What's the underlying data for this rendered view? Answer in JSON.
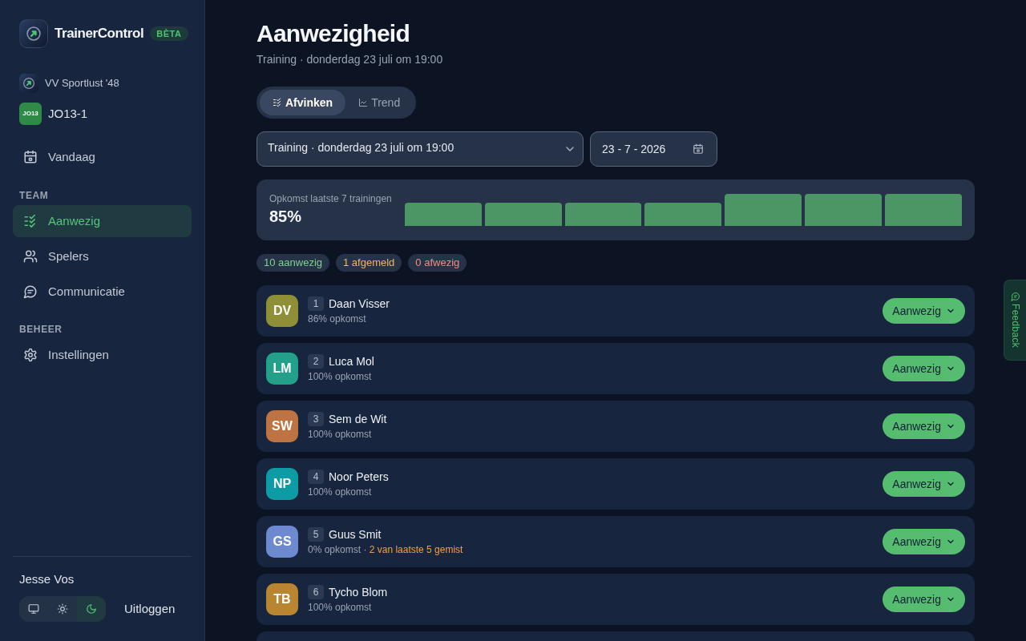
{
  "sidebar": {
    "brand": {
      "name": "TrainerControl",
      "badge": "BÈTA"
    },
    "club": {
      "name": "VV Sportlust '48"
    },
    "team": {
      "badge": "JO13",
      "name": "JO13-1"
    },
    "nav": [
      {
        "label": "Vandaag",
        "kind": "calendar",
        "selected": false
      }
    ],
    "sections": [
      {
        "title": "TEAM",
        "items": [
          {
            "label": "Aanwezig",
            "kind": "checklist",
            "selected": true
          },
          {
            "label": "Spelers",
            "kind": "users",
            "selected": false
          },
          {
            "label": "Communicatie",
            "kind": "chat",
            "selected": false
          }
        ]
      },
      {
        "title": "BEHEER",
        "items": [
          {
            "label": "Instellingen",
            "kind": "settings",
            "selected": false
          }
        ]
      }
    ],
    "user": {
      "name": "Jesse Vos"
    },
    "theme_options": [
      {
        "kind": "system",
        "selected": false
      },
      {
        "kind": "light",
        "selected": false
      },
      {
        "kind": "dark",
        "selected": true
      }
    ],
    "logout": "Uitloggen"
  },
  "header": {
    "title": "Aanwezigheid",
    "subtitle": "Training · donderdag 23 juli om 19:00"
  },
  "tabs": [
    {
      "label": "Afvinken",
      "kind": "checklist",
      "selected": true
    },
    {
      "label": "Trend",
      "kind": "chart",
      "selected": false
    }
  ],
  "session_select": {
    "value": "Training · donderdag 23 juli om 19:00"
  },
  "date_field": {
    "value": "23 - 7 - 2026"
  },
  "summary": {
    "label": "Opkomst laatste 7 trainingen",
    "value": "85%"
  },
  "counts": [
    {
      "label": "10 aanwezig",
      "kind": "present"
    },
    {
      "label": "1 afgemeld",
      "kind": "excused"
    },
    {
      "label": "0 afwezig",
      "kind": "absent"
    }
  ],
  "players": [
    {
      "initials": "DV",
      "color": "#8e8f36",
      "number": "1",
      "name": "Daan Visser",
      "attendance": "86% opkomst",
      "status": "Aanwezig"
    },
    {
      "initials": "LM",
      "color": "#22a08a",
      "number": "2",
      "name": "Luca Mol",
      "attendance": "100% opkomst",
      "status": "Aanwezig"
    },
    {
      "initials": "SW",
      "color": "#bd7442",
      "number": "3",
      "name": "Sem de Wit",
      "attendance": "100% opkomst",
      "status": "Aanwezig"
    },
    {
      "initials": "NP",
      "color": "#0d9ca6",
      "number": "4",
      "name": "Noor Peters",
      "attendance": "100% opkomst",
      "status": "Aanwezig"
    },
    {
      "initials": "GS",
      "color": "#6d89cf",
      "number": "5",
      "name": "Guus Smit",
      "attendance": "0% opkomst",
      "warning": "· 2 van laatste 5 gemist",
      "status": "Aanwezig"
    },
    {
      "initials": "TB",
      "color": "#b98530",
      "number": "6",
      "name": "Tycho Blom",
      "attendance": "100% opkomst",
      "status": "Aanwezig"
    }
  ],
  "feedback": {
    "label": "Feedback"
  }
}
